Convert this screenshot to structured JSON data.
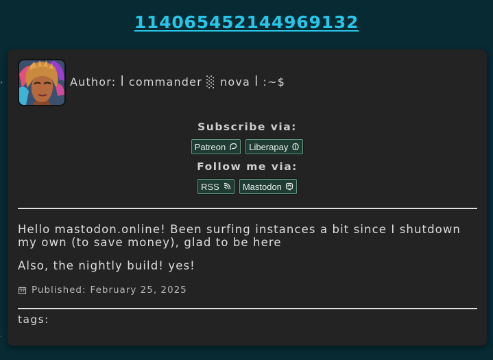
{
  "post": {
    "id": "114065452144969132"
  },
  "author": {
    "label": "Author:",
    "name": "ꟾ commander ░ nova ꟾ :~$"
  },
  "subscribe": {
    "title": "Subscribe via:",
    "buttons": [
      {
        "label": "Patreon",
        "icon": "patreon-icon"
      },
      {
        "label": "Liberapay",
        "icon": "liberapay-icon"
      }
    ]
  },
  "follow": {
    "title": "Follow me via:",
    "buttons": [
      {
        "label": "RSS",
        "icon": "rss-icon"
      },
      {
        "label": "Mastodon",
        "icon": "mastodon-icon"
      }
    ]
  },
  "content": {
    "paragraphs": [
      "Hello mastodon.online! Been surfing instances a bit since I shutdown my own (to save money), glad to be here",
      "Also, the nightly build! yes!"
    ]
  },
  "meta": {
    "published_label": "Published:",
    "published_date": "February 25, 2025",
    "tags_label": "tags:"
  },
  "colors": {
    "page_background": "#072a33",
    "card_background": "#232323",
    "link_accent": "#27c6e8",
    "button_background": "#1f3b33",
    "button_border": "#6d9b84"
  }
}
